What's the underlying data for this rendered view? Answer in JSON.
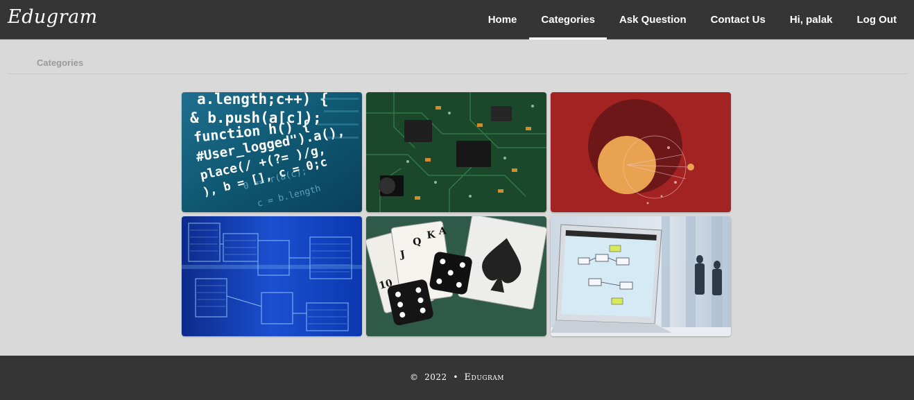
{
  "header": {
    "brand": "Edugram",
    "nav": [
      {
        "label": "Home",
        "active": false
      },
      {
        "label": "Categories",
        "active": true
      },
      {
        "label": "Ask Question",
        "active": false
      },
      {
        "label": "Contact Us",
        "active": false
      },
      {
        "label": "Hi, palak",
        "active": false
      },
      {
        "label": "Log Out",
        "active": false
      }
    ]
  },
  "breadcrumb": "Categories",
  "code_snippet": {
    "line1": "a.length;c++) {",
    "line2": "& b.push(a[c]);",
    "line3": "function h() {",
    "line4": "#User_logged\").a(),",
    "line5": "place(/ +(?= )/g,",
    "line6": "), b = [], c = 0;c",
    "line7": "0 == r(a(c);",
    "line8": "c = b.length"
  },
  "categories": [
    {
      "image": "programming-code-image"
    },
    {
      "image": "circuit-board-image"
    },
    {
      "image": "venn-circles-image"
    },
    {
      "image": "database-schema-image"
    },
    {
      "image": "cards-dice-image"
    },
    {
      "image": "laptop-flowchart-image"
    }
  ],
  "footer": {
    "copyright": "©",
    "year": "2022",
    "separator": "•",
    "name": "Edugram"
  },
  "colors": {
    "navbar": "#353535",
    "page_bg": "#d9d9d9",
    "active_underline": "#ffffff"
  }
}
